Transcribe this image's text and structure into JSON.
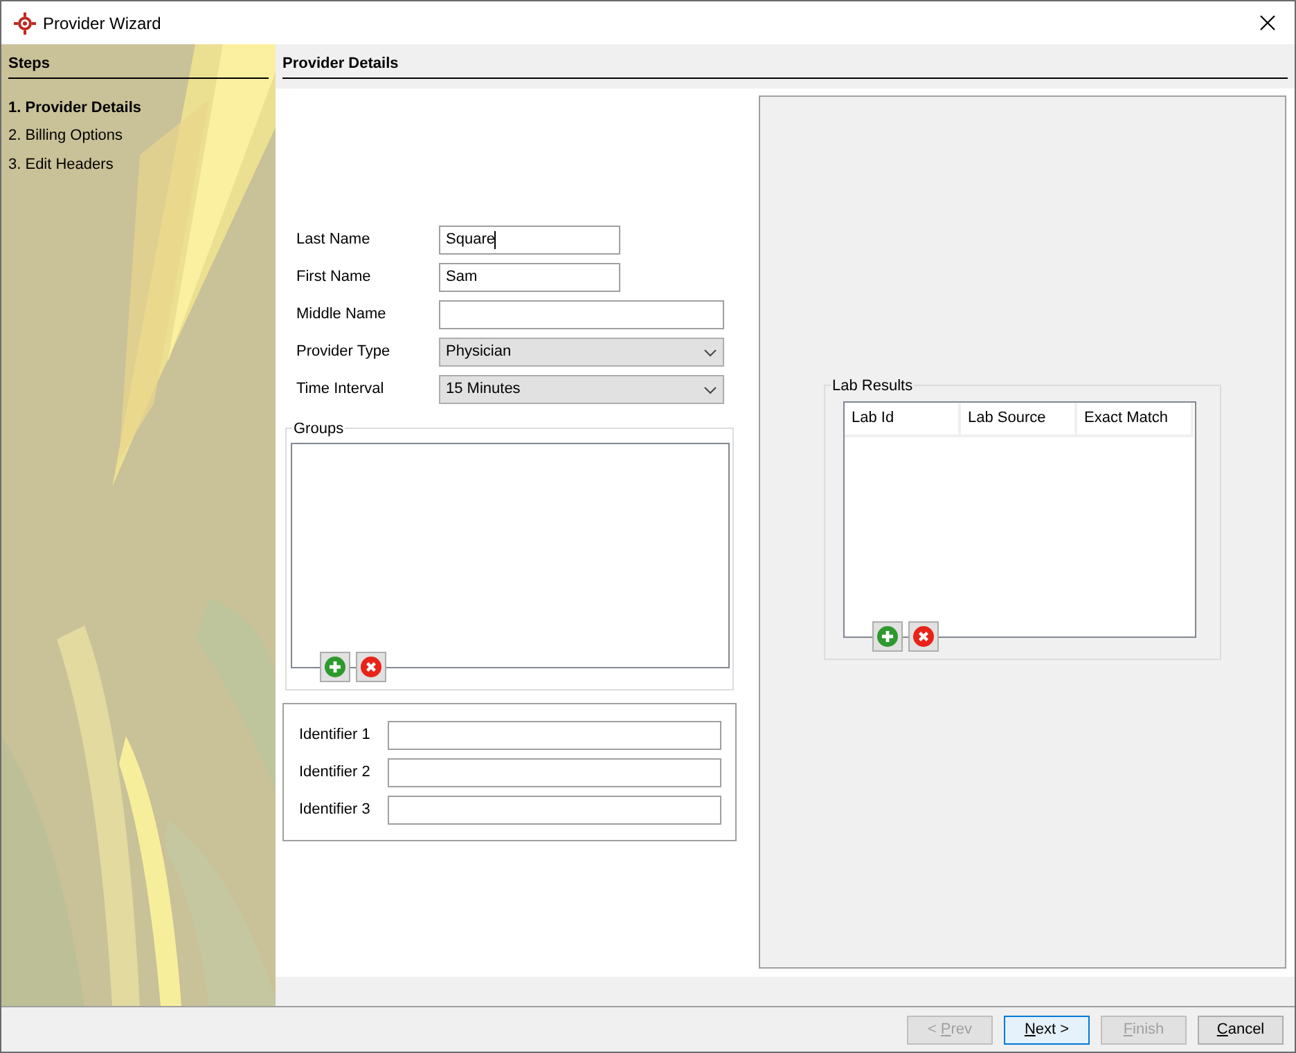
{
  "window": {
    "title": "Provider Wizard"
  },
  "sidebar": {
    "title": "Steps",
    "items": [
      {
        "label": "1. Provider Details",
        "selected": true
      },
      {
        "label": "2. Billing Options",
        "selected": false
      },
      {
        "label": "3. Edit Headers",
        "selected": false
      }
    ]
  },
  "page": {
    "title": "Provider Details"
  },
  "form": [
    {
      "kind": "text",
      "label": "Last Name",
      "value": "Square",
      "focused": true,
      "wide": false
    },
    {
      "kind": "text",
      "label": "First Name",
      "value": "Sam",
      "focused": false,
      "wide": false
    },
    {
      "kind": "text",
      "label": "Middle Name",
      "focused": false,
      "wide": true
    },
    {
      "kind": "select",
      "label": "Provider Type",
      "value": "Physician"
    },
    {
      "kind": "select",
      "label": "Time Interval",
      "value": "15 Minutes"
    }
  ],
  "groups": {
    "title": "Groups"
  },
  "identifiers": [
    {
      "label": "Identifier 1"
    },
    {
      "label": "Identifier 2"
    },
    {
      "label": "Identifier 3"
    }
  ],
  "lab_results": {
    "title": "Lab Results",
    "columns": [
      "Lab Id",
      "Lab Source",
      "Exact Match"
    ]
  },
  "buttons": [
    {
      "pre": "< ",
      "key": "P",
      "post": "rev",
      "disabled": true,
      "default": false
    },
    {
      "key": "N",
      "post": "ext >",
      "disabled": false,
      "default": true
    },
    {
      "key": "F",
      "post": "inish",
      "disabled": true,
      "default": false
    },
    {
      "key": "C",
      "post": "ancel",
      "disabled": false,
      "default": false
    }
  ]
}
